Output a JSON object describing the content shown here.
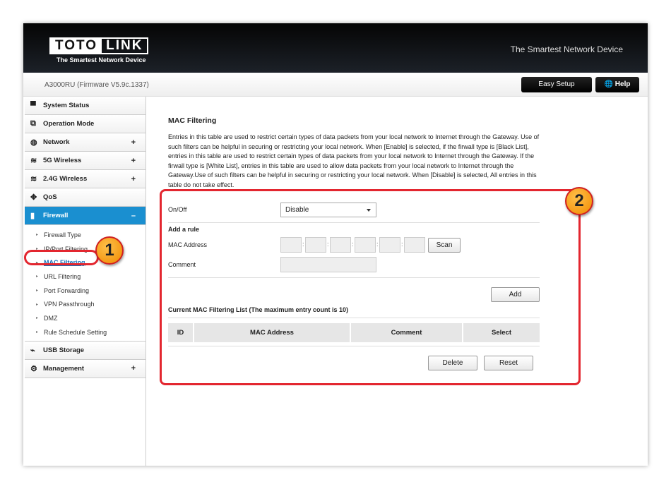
{
  "header": {
    "logo_left": "TOTO",
    "logo_right": "LINK",
    "logo_sub": "The Smartest Network Device",
    "tagline": "The Smartest Network Device"
  },
  "subheader": {
    "model": "A3000RU (Firmware V5.9c.1337)",
    "easy_setup": "Easy Setup",
    "help": "Help"
  },
  "sidebar": {
    "items": [
      {
        "label": "System Status",
        "icon": "chat-icon",
        "expand": ""
      },
      {
        "label": "Operation Mode",
        "icon": "windows-icon",
        "expand": ""
      },
      {
        "label": "Network",
        "icon": "globe-icon",
        "expand": "+"
      },
      {
        "label": "5G Wireless",
        "icon": "wifi-icon",
        "expand": "+"
      },
      {
        "label": "2.4G Wireless",
        "icon": "wifi-icon",
        "expand": "+"
      },
      {
        "label": "QoS",
        "icon": "qos-icon",
        "expand": ""
      },
      {
        "label": "Firewall",
        "icon": "shield-icon",
        "expand": "–"
      }
    ],
    "firewall_sub": [
      "Firewall Type",
      "IP/Port Filtering",
      "MAC Filtering",
      "URL Filtering",
      "Port Forwarding",
      "VPN Passthrough",
      "DMZ",
      "Rule Schedule Setting"
    ],
    "bottom": [
      {
        "label": "USB Storage",
        "icon": "usb-icon",
        "expand": ""
      },
      {
        "label": "Management",
        "icon": "gear-icon",
        "expand": "+"
      }
    ]
  },
  "main": {
    "title": "MAC Filtering",
    "description": "Entries in this table are used to restrict certain types of data packets from your local network to Internet through the Gateway. Use of such filters can be helpful in securing or restricting your local network. When [Enable] is selected, if the firwall type is [Black List], entries in this table are used to restrict certain types of data packets from your local network to Internet through the Gateway. If the firwall type is [White List], entries in this table are used to allow data packets from your local network to Internet through the Gateway.Use of such filters can be helpful in securing or restricting your local network. When [Disable] is selected, All entries in this table do not take effect.",
    "onoff_label": "On/Off",
    "onoff_value": "Disable",
    "add_rule": "Add a rule",
    "mac_label": "MAC Address",
    "scan": "Scan",
    "comment_label": "Comment",
    "add": "Add",
    "list_title": "Current MAC Filtering List  (The maximum entry count is 10)",
    "columns": [
      "ID",
      "MAC Address",
      "Comment",
      "Select"
    ],
    "delete": "Delete",
    "reset": "Reset"
  },
  "annotations": {
    "badge1": "1",
    "badge2": "2",
    "color": "#e3262f"
  }
}
